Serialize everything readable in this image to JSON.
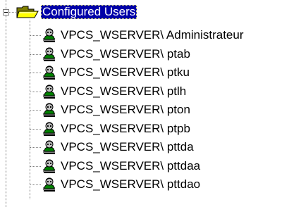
{
  "tree": {
    "root": {
      "label": "Configured Users",
      "icon": "open-folder-icon",
      "expanded": true,
      "selected": true
    },
    "users": [
      {
        "label": "VPCS_WSERVER\\ Administrateur",
        "icon": "user-icon"
      },
      {
        "label": "VPCS_WSERVER\\ ptab",
        "icon": "user-icon"
      },
      {
        "label": "VPCS_WSERVER\\ ptku",
        "icon": "user-icon"
      },
      {
        "label": "VPCS_WSERVER\\ ptlh",
        "icon": "user-icon"
      },
      {
        "label": "VPCS_WSERVER\\ pton",
        "icon": "user-icon"
      },
      {
        "label": "VPCS_WSERVER\\ ptpb",
        "icon": "user-icon"
      },
      {
        "label": "VPCS_WSERVER\\ pttda",
        "icon": "user-icon"
      },
      {
        "label": "VPCS_WSERVER\\ pttdaa",
        "icon": "user-icon"
      },
      {
        "label": "VPCS_WSERVER\\ pttdao",
        "icon": "user-icon"
      }
    ]
  },
  "colors": {
    "selection_bg": "#0000a8",
    "selection_text": "#ffffff",
    "tree_line": "#808080",
    "folder_yellow": "#ffff00",
    "folder_dark": "#808000",
    "user_body": "#008000"
  }
}
